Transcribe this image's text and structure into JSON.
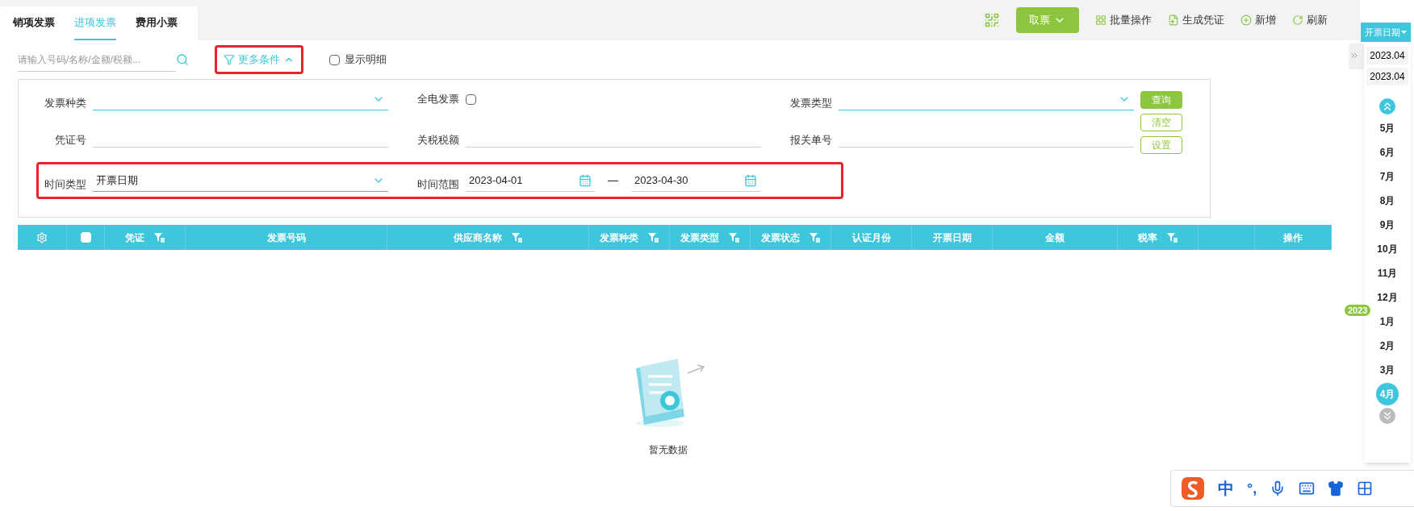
{
  "tabs": [
    {
      "label": "销项发票",
      "selected": false
    },
    {
      "label": "进项发票",
      "selected": true
    },
    {
      "label": "费用小票",
      "selected": false
    }
  ],
  "toolbar": {
    "pick_button": "取票",
    "actions": [
      {
        "kind": "batch",
        "label": "批量操作"
      },
      {
        "kind": "voucher",
        "label": "生成凭证"
      },
      {
        "kind": "add",
        "label": "新增"
      },
      {
        "kind": "refresh",
        "label": "刷新"
      }
    ]
  },
  "search": {
    "placeholder": "请输入号码/名称/金额/税额..."
  },
  "more_conditions": {
    "label": "更多条件",
    "expanded": true,
    "highlighted": true
  },
  "show_detail": {
    "label": "显示明细",
    "checked": false
  },
  "filter_rows": [
    {
      "highlighted": false,
      "fields": [
        {
          "kind": "select",
          "label": "发票种类"
        },
        {
          "kind": "checkbox",
          "label": "全电发票",
          "checked": false
        },
        {
          "kind": "select",
          "label": "发票类型"
        }
      ]
    },
    {
      "highlighted": false,
      "fields": [
        {
          "kind": "text",
          "label": "凭证号"
        },
        {
          "kind": "text",
          "label": "关税税额"
        },
        {
          "kind": "text",
          "label": "报关单号"
        }
      ]
    },
    {
      "highlighted": true,
      "fields": [
        {
          "kind": "select",
          "label": "时间类型",
          "value": "开票日期"
        },
        {
          "kind": "date_range",
          "label": "时间范围",
          "from": "2023-04-01",
          "separator": "—",
          "to": "2023-04-30"
        }
      ]
    }
  ],
  "filter_buttons": [
    {
      "kind": "primary",
      "label": "查询"
    },
    {
      "kind": "outline",
      "label": "清空"
    },
    {
      "kind": "outline",
      "label": "设置"
    }
  ],
  "table": {
    "columns": [
      {
        "kind": "settings"
      },
      {
        "kind": "checkbox",
        "checked": false
      },
      {
        "label": "凭证",
        "filter": true
      },
      {
        "label": "发票号码",
        "filter": false
      },
      {
        "label": "供应商名称",
        "filter": true
      },
      {
        "label": "发票种类",
        "filter": true
      },
      {
        "label": "发票类型",
        "filter": true
      },
      {
        "label": "发票状态",
        "filter": true
      },
      {
        "label": "认证月份",
        "filter": false
      },
      {
        "label": "开票日期",
        "filter": false
      },
      {
        "label": "金额",
        "filter": false
      },
      {
        "label": "税率",
        "filter": true
      },
      {
        "filter": false
      },
      {
        "label": "操作",
        "filter": false
      }
    ]
  },
  "empty_state": {
    "text": "暂无数据"
  },
  "date_panel": {
    "mode": "开票日期",
    "ranges": [
      "2023.04",
      "2023.04"
    ],
    "months": [
      {
        "label": "5月",
        "selected": false
      },
      {
        "label": "6月",
        "selected": false
      },
      {
        "label": "7月",
        "selected": false
      },
      {
        "label": "8月",
        "selected": false
      },
      {
        "label": "9月",
        "selected": false
      },
      {
        "label": "10月",
        "selected": false
      },
      {
        "label": "11月",
        "selected": false
      },
      {
        "label": "12月",
        "selected": false
      },
      {
        "label": "1月",
        "selected": false,
        "year": "2023"
      },
      {
        "label": "2月",
        "selected": false
      },
      {
        "label": "3月",
        "selected": false
      },
      {
        "label": "4月",
        "selected": true
      }
    ]
  },
  "ime_bar": {
    "language": "中",
    "punctuation": "°,"
  }
}
